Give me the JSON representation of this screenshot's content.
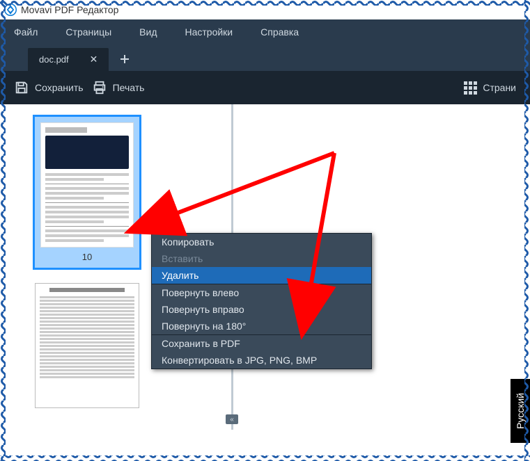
{
  "window": {
    "title": "Movavi PDF Редактор"
  },
  "menu": {
    "file": "Файл",
    "pages": "Страницы",
    "view": "Вид",
    "settings": "Настройки",
    "help": "Справка"
  },
  "tabs": {
    "active": "doc.pdf"
  },
  "toolbar": {
    "save": "Сохранить",
    "print": "Печать",
    "pages": "Страни"
  },
  "thumbnails": {
    "selected_label": "10"
  },
  "context_menu": {
    "copy": "Копировать",
    "paste": "Вставить",
    "delete": "Удалить",
    "rotate_left": "Повернуть влево",
    "rotate_right": "Повернуть вправо",
    "rotate_180": "Повернуть на 180°",
    "save_pdf": "Сохранить в PDF",
    "convert": "Конвертировать в JPG, PNG, BMP"
  },
  "side_tab": {
    "label": "Русский"
  }
}
